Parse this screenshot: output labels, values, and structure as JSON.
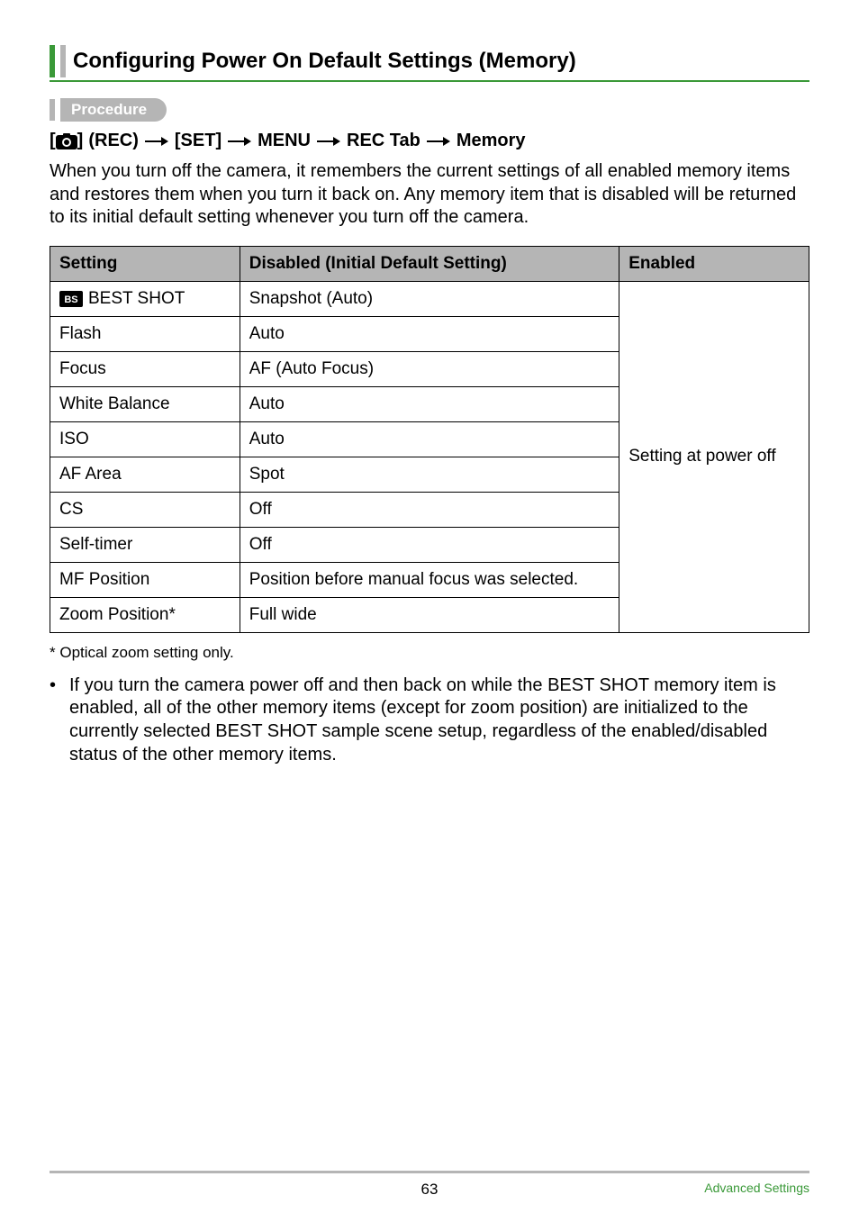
{
  "heading": "Configuring Power On Default Settings (Memory)",
  "procedure_label": "Procedure",
  "path": {
    "rec": "(REC)",
    "set": "[SET]",
    "menu": "MENU",
    "tab": "REC Tab",
    "memory": "Memory"
  },
  "body": "When you turn off the camera, it remembers the current settings of all enabled memory items and restores them when you turn it back on. Any memory item that is disabled will be returned to its initial default setting whenever you turn off the camera.",
  "table": {
    "headers": {
      "setting": "Setting",
      "disabled": "Disabled (Initial Default Setting)",
      "enabled": "Enabled"
    },
    "enabled_value": "Setting at power off",
    "rows": [
      {
        "setting": "BEST SHOT",
        "disabled": "Snapshot (Auto)",
        "has_bs_icon": true
      },
      {
        "setting": "Flash",
        "disabled": "Auto"
      },
      {
        "setting": "Focus",
        "disabled": "AF (Auto Focus)"
      },
      {
        "setting": "White Balance",
        "disabled": "Auto"
      },
      {
        "setting": "ISO",
        "disabled": "Auto"
      },
      {
        "setting": "AF Area",
        "disabled": "Spot"
      },
      {
        "setting": "CS",
        "disabled": "Off"
      },
      {
        "setting": "Self-timer",
        "disabled": "Off"
      },
      {
        "setting": "MF Position",
        "disabled": "Position before manual focus was selected."
      },
      {
        "setting": "Zoom Position*",
        "disabled": "Full wide"
      }
    ]
  },
  "footnote": "Optical zoom setting only.",
  "footnote_marker": "*",
  "bullet": "If you turn the camera power off and then back on while the BEST SHOT memory item is enabled, all of the other memory items (except for zoom position) are initialized to the currently selected BEST SHOT sample scene setup, regardless of the enabled/disabled status of the other memory items.",
  "footer": {
    "page": "63",
    "section": "Advanced Settings"
  }
}
